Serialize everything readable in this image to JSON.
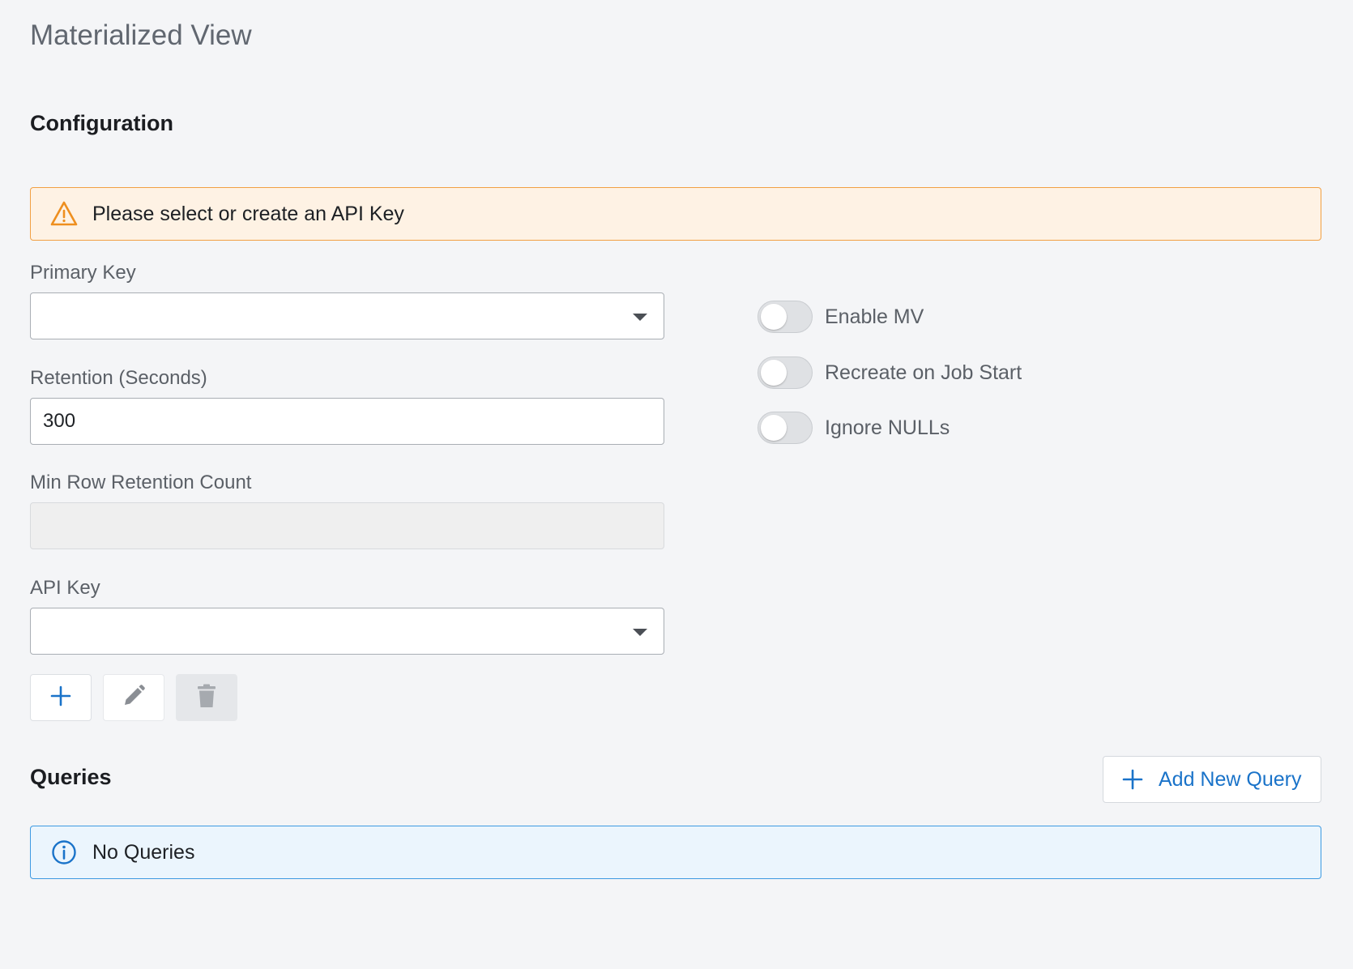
{
  "page": {
    "title": "Materialized View"
  },
  "configuration": {
    "title": "Configuration",
    "warning": "Please select or create an API Key",
    "primary_key": {
      "label": "Primary Key",
      "value": ""
    },
    "retention": {
      "label": "Retention (Seconds)",
      "value": "300"
    },
    "min_row_retention": {
      "label": "Min Row Retention Count",
      "value": ""
    },
    "api_key": {
      "label": "API Key",
      "value": ""
    },
    "toggles": [
      {
        "label": "Enable MV",
        "on": false
      },
      {
        "label": "Recreate on Job Start",
        "on": false
      },
      {
        "label": "Ignore NULLs",
        "on": false
      }
    ]
  },
  "queries": {
    "title": "Queries",
    "add_button": "Add New Query",
    "empty_message": "No Queries"
  },
  "colors": {
    "accent": "#1a73c9",
    "warning_border": "#f1a043",
    "warning_bg": "#fef2e4",
    "info_border": "#3d9ae2",
    "info_bg": "#ebf5fd"
  },
  "icons": [
    "warning-icon",
    "chevron-down-icon",
    "plus-icon",
    "pencil-icon",
    "trash-icon",
    "info-icon"
  ]
}
